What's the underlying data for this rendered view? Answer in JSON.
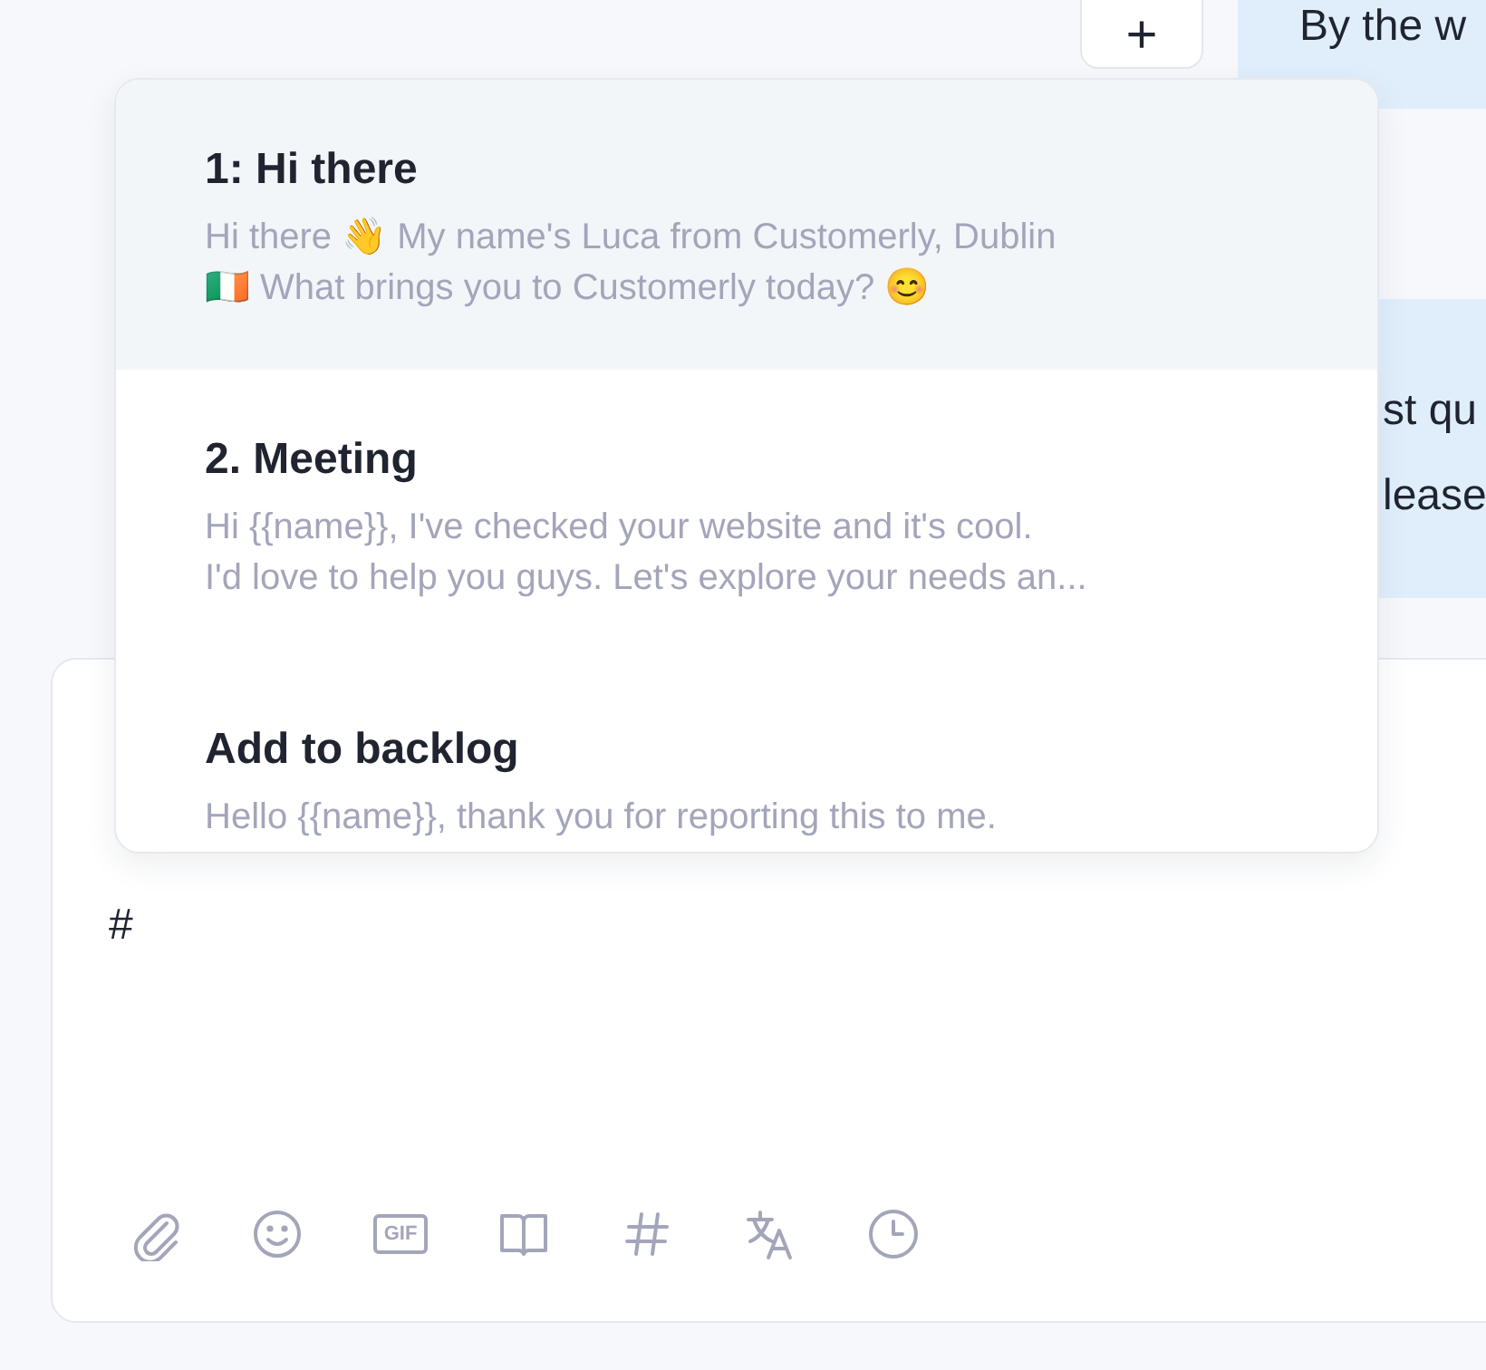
{
  "add_button": {
    "label": "+"
  },
  "messages": [
    {
      "lines": [
        "By the w"
      ]
    },
    {
      "lines": [
        "st qu",
        "lease"
      ]
    }
  ],
  "snippet_menu": {
    "items": [
      {
        "title": "1: Hi there",
        "preview": [
          "Hi there 👋  My name's Luca from Customerly, Dublin",
          "🇮🇪 What brings you to Customerly today? 😊"
        ],
        "selected": true
      },
      {
        "title": "2. Meeting",
        "preview": [
          "Hi {{name}}, I've checked your website and it's cool.",
          "I'd love to help you guys. Let's explore your needs an..."
        ],
        "selected": false
      },
      {
        "title": "Add to backlog",
        "preview": [
          "Hello {{name}}, thank you for reporting this to me."
        ],
        "selected": false
      }
    ]
  },
  "composer": {
    "value": "#",
    "toolbar": [
      {
        "kind": "attach"
      },
      {
        "kind": "emoji"
      },
      {
        "kind": "gif",
        "label": "GIF"
      },
      {
        "kind": "book"
      },
      {
        "kind": "hash"
      },
      {
        "kind": "translate"
      },
      {
        "kind": "clock"
      }
    ]
  }
}
